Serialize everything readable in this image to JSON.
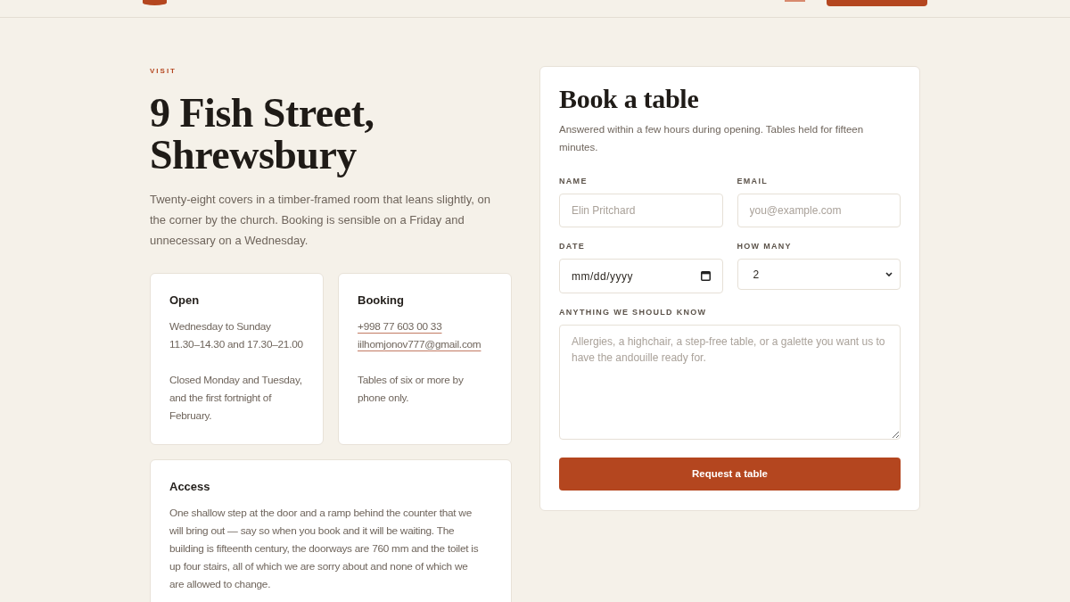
{
  "section": {
    "eyebrow": "VISIT",
    "title": "9 Fish Street, Shrewsbury",
    "intro": "Twenty-eight covers in a timber-framed room that leans slightly, on the corner by the church. Booking is sensible on a Friday and unnecessary on a Wednesday."
  },
  "cards": [
    {
      "title": "Open",
      "blocks": [
        {
          "kind": "lines",
          "lines": [
            "Wednesday to Sunday",
            "11.30–14.30 and 17.30–21.00"
          ]
        },
        {
          "kind": "paragraph",
          "text": "Closed Monday and Tuesday, and the first fortnight of February."
        }
      ]
    },
    {
      "title": "Booking",
      "blocks": [
        {
          "kind": "links",
          "links": [
            "+998 77 603 00 33",
            "iilhomjonov777@gmail.com"
          ]
        },
        {
          "kind": "paragraph",
          "text": "Tables of six or more by phone only."
        }
      ]
    },
    {
      "title": "Access",
      "blocks": [
        {
          "kind": "paragraph",
          "text": "One shallow step at the door and a ramp behind the counter that we will bring out — say so when you book and it will be waiting. The building is fifteenth century, the doorways are 760 mm and the toilet is up four stairs, all of which we are sorry about and none of which we are allowed to change."
        }
      ]
    }
  ],
  "booking_form": {
    "title": "Book a table",
    "note": "Answered within a few hours during opening. Tables held for fifteen minutes.",
    "fields": [
      {
        "kind": "text",
        "label": "NAME",
        "placeholder": "Elin Pritchard"
      },
      {
        "kind": "text",
        "label": "EMAIL",
        "placeholder": "you@example.com"
      },
      {
        "kind": "date",
        "label": "DATE",
        "placeholder": "mm/dd/yyyy"
      },
      {
        "kind": "select",
        "label": "HOW MANY",
        "value": "2"
      },
      {
        "kind": "textarea",
        "label": "ANYTHING WE SHOULD KNOW",
        "placeholder": "Allergies, a highchair, a step-free table, or a galette you want us to have the andouille ready for."
      }
    ],
    "submit": "Request a table"
  }
}
